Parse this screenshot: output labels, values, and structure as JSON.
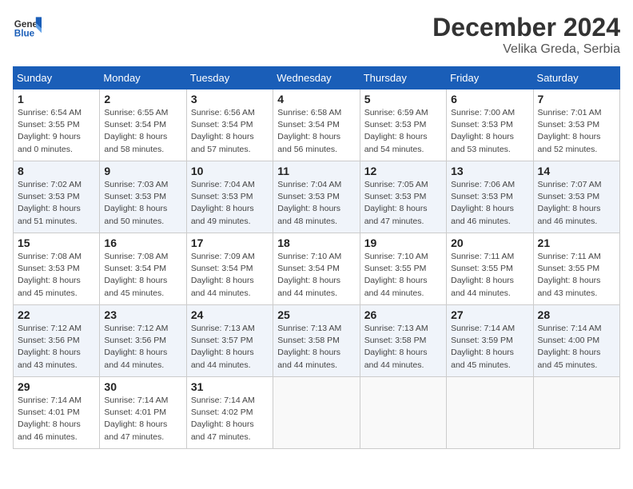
{
  "header": {
    "logo_general": "General",
    "logo_blue": "Blue",
    "month_year": "December 2024",
    "location": "Velika Greda, Serbia"
  },
  "days_of_week": [
    "Sunday",
    "Monday",
    "Tuesday",
    "Wednesday",
    "Thursday",
    "Friday",
    "Saturday"
  ],
  "weeks": [
    [
      {
        "day": "1",
        "info": "Sunrise: 6:54 AM\nSunset: 3:55 PM\nDaylight: 9 hours\nand 0 minutes."
      },
      {
        "day": "2",
        "info": "Sunrise: 6:55 AM\nSunset: 3:54 PM\nDaylight: 8 hours\nand 58 minutes."
      },
      {
        "day": "3",
        "info": "Sunrise: 6:56 AM\nSunset: 3:54 PM\nDaylight: 8 hours\nand 57 minutes."
      },
      {
        "day": "4",
        "info": "Sunrise: 6:58 AM\nSunset: 3:54 PM\nDaylight: 8 hours\nand 56 minutes."
      },
      {
        "day": "5",
        "info": "Sunrise: 6:59 AM\nSunset: 3:53 PM\nDaylight: 8 hours\nand 54 minutes."
      },
      {
        "day": "6",
        "info": "Sunrise: 7:00 AM\nSunset: 3:53 PM\nDaylight: 8 hours\nand 53 minutes."
      },
      {
        "day": "7",
        "info": "Sunrise: 7:01 AM\nSunset: 3:53 PM\nDaylight: 8 hours\nand 52 minutes."
      }
    ],
    [
      {
        "day": "8",
        "info": "Sunrise: 7:02 AM\nSunset: 3:53 PM\nDaylight: 8 hours\nand 51 minutes."
      },
      {
        "day": "9",
        "info": "Sunrise: 7:03 AM\nSunset: 3:53 PM\nDaylight: 8 hours\nand 50 minutes."
      },
      {
        "day": "10",
        "info": "Sunrise: 7:04 AM\nSunset: 3:53 PM\nDaylight: 8 hours\nand 49 minutes."
      },
      {
        "day": "11",
        "info": "Sunrise: 7:04 AM\nSunset: 3:53 PM\nDaylight: 8 hours\nand 48 minutes."
      },
      {
        "day": "12",
        "info": "Sunrise: 7:05 AM\nSunset: 3:53 PM\nDaylight: 8 hours\nand 47 minutes."
      },
      {
        "day": "13",
        "info": "Sunrise: 7:06 AM\nSunset: 3:53 PM\nDaylight: 8 hours\nand 46 minutes."
      },
      {
        "day": "14",
        "info": "Sunrise: 7:07 AM\nSunset: 3:53 PM\nDaylight: 8 hours\nand 46 minutes."
      }
    ],
    [
      {
        "day": "15",
        "info": "Sunrise: 7:08 AM\nSunset: 3:53 PM\nDaylight: 8 hours\nand 45 minutes."
      },
      {
        "day": "16",
        "info": "Sunrise: 7:08 AM\nSunset: 3:54 PM\nDaylight: 8 hours\nand 45 minutes."
      },
      {
        "day": "17",
        "info": "Sunrise: 7:09 AM\nSunset: 3:54 PM\nDaylight: 8 hours\nand 44 minutes."
      },
      {
        "day": "18",
        "info": "Sunrise: 7:10 AM\nSunset: 3:54 PM\nDaylight: 8 hours\nand 44 minutes."
      },
      {
        "day": "19",
        "info": "Sunrise: 7:10 AM\nSunset: 3:55 PM\nDaylight: 8 hours\nand 44 minutes."
      },
      {
        "day": "20",
        "info": "Sunrise: 7:11 AM\nSunset: 3:55 PM\nDaylight: 8 hours\nand 44 minutes."
      },
      {
        "day": "21",
        "info": "Sunrise: 7:11 AM\nSunset: 3:55 PM\nDaylight: 8 hours\nand 43 minutes."
      }
    ],
    [
      {
        "day": "22",
        "info": "Sunrise: 7:12 AM\nSunset: 3:56 PM\nDaylight: 8 hours\nand 43 minutes."
      },
      {
        "day": "23",
        "info": "Sunrise: 7:12 AM\nSunset: 3:56 PM\nDaylight: 8 hours\nand 44 minutes."
      },
      {
        "day": "24",
        "info": "Sunrise: 7:13 AM\nSunset: 3:57 PM\nDaylight: 8 hours\nand 44 minutes."
      },
      {
        "day": "25",
        "info": "Sunrise: 7:13 AM\nSunset: 3:58 PM\nDaylight: 8 hours\nand 44 minutes."
      },
      {
        "day": "26",
        "info": "Sunrise: 7:13 AM\nSunset: 3:58 PM\nDaylight: 8 hours\nand 44 minutes."
      },
      {
        "day": "27",
        "info": "Sunrise: 7:14 AM\nSunset: 3:59 PM\nDaylight: 8 hours\nand 45 minutes."
      },
      {
        "day": "28",
        "info": "Sunrise: 7:14 AM\nSunset: 4:00 PM\nDaylight: 8 hours\nand 45 minutes."
      }
    ],
    [
      {
        "day": "29",
        "info": "Sunrise: 7:14 AM\nSunset: 4:01 PM\nDaylight: 8 hours\nand 46 minutes."
      },
      {
        "day": "30",
        "info": "Sunrise: 7:14 AM\nSunset: 4:01 PM\nDaylight: 8 hours\nand 47 minutes."
      },
      {
        "day": "31",
        "info": "Sunrise: 7:14 AM\nSunset: 4:02 PM\nDaylight: 8 hours\nand 47 minutes."
      },
      null,
      null,
      null,
      null
    ]
  ]
}
